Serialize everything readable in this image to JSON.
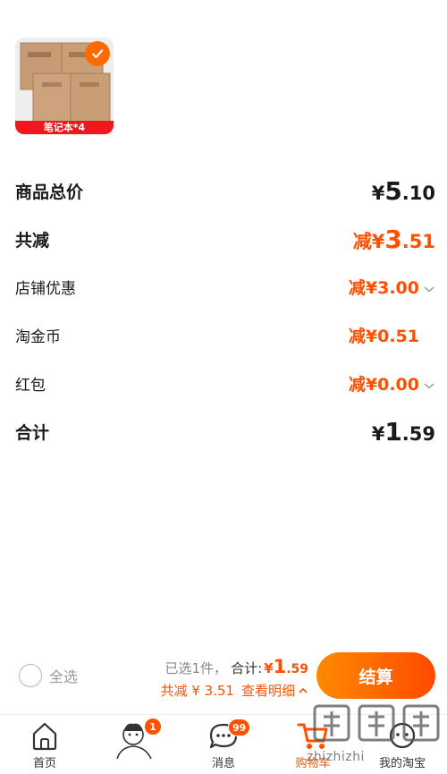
{
  "product": {
    "thumb_label": "笔记本*4",
    "selected": true
  },
  "summary": {
    "total_price": {
      "label": "商品总价",
      "currency": "¥",
      "int": "5",
      "dec": ".10"
    },
    "total_discount": {
      "label": "共减",
      "prefix": "减",
      "currency": "¥",
      "int": "3",
      "dec": ".51"
    },
    "store_discount": {
      "label": "店铺优惠",
      "value": "减¥3.00"
    },
    "taojinbi": {
      "label": "淘金币",
      "value": "减¥0.51"
    },
    "red_packet": {
      "label": "红包",
      "value": "减¥0.00"
    },
    "grand_total": {
      "label": "合计",
      "currency": "¥",
      "int": "1",
      "dec": ".59"
    }
  },
  "checkout": {
    "select_all_label": "全选",
    "selected_count": "已选1件，",
    "total_label": "合计:",
    "total_currency": "¥",
    "total_int": "1",
    "total_dec": ".59",
    "discount_text": "共减 ¥ 3.51",
    "detail_link": "查看明细",
    "button_label": "结算"
  },
  "tabbar": {
    "tabs": [
      {
        "label": "首页",
        "icon": "home-icon"
      },
      {
        "label": "",
        "icon": "avatar-icon",
        "badge": "1"
      },
      {
        "label": "消息",
        "icon": "message-icon",
        "badge": "99"
      },
      {
        "label": "购物车",
        "icon": "cart-icon",
        "active": true
      },
      {
        "label": "我的淘宝",
        "icon": "profile-icon"
      }
    ]
  },
  "watermark": {
    "text": "zhizhizhi"
  },
  "colors": {
    "accent": "#ff5000",
    "label_red": "#f2161d",
    "gray": "#999999"
  }
}
